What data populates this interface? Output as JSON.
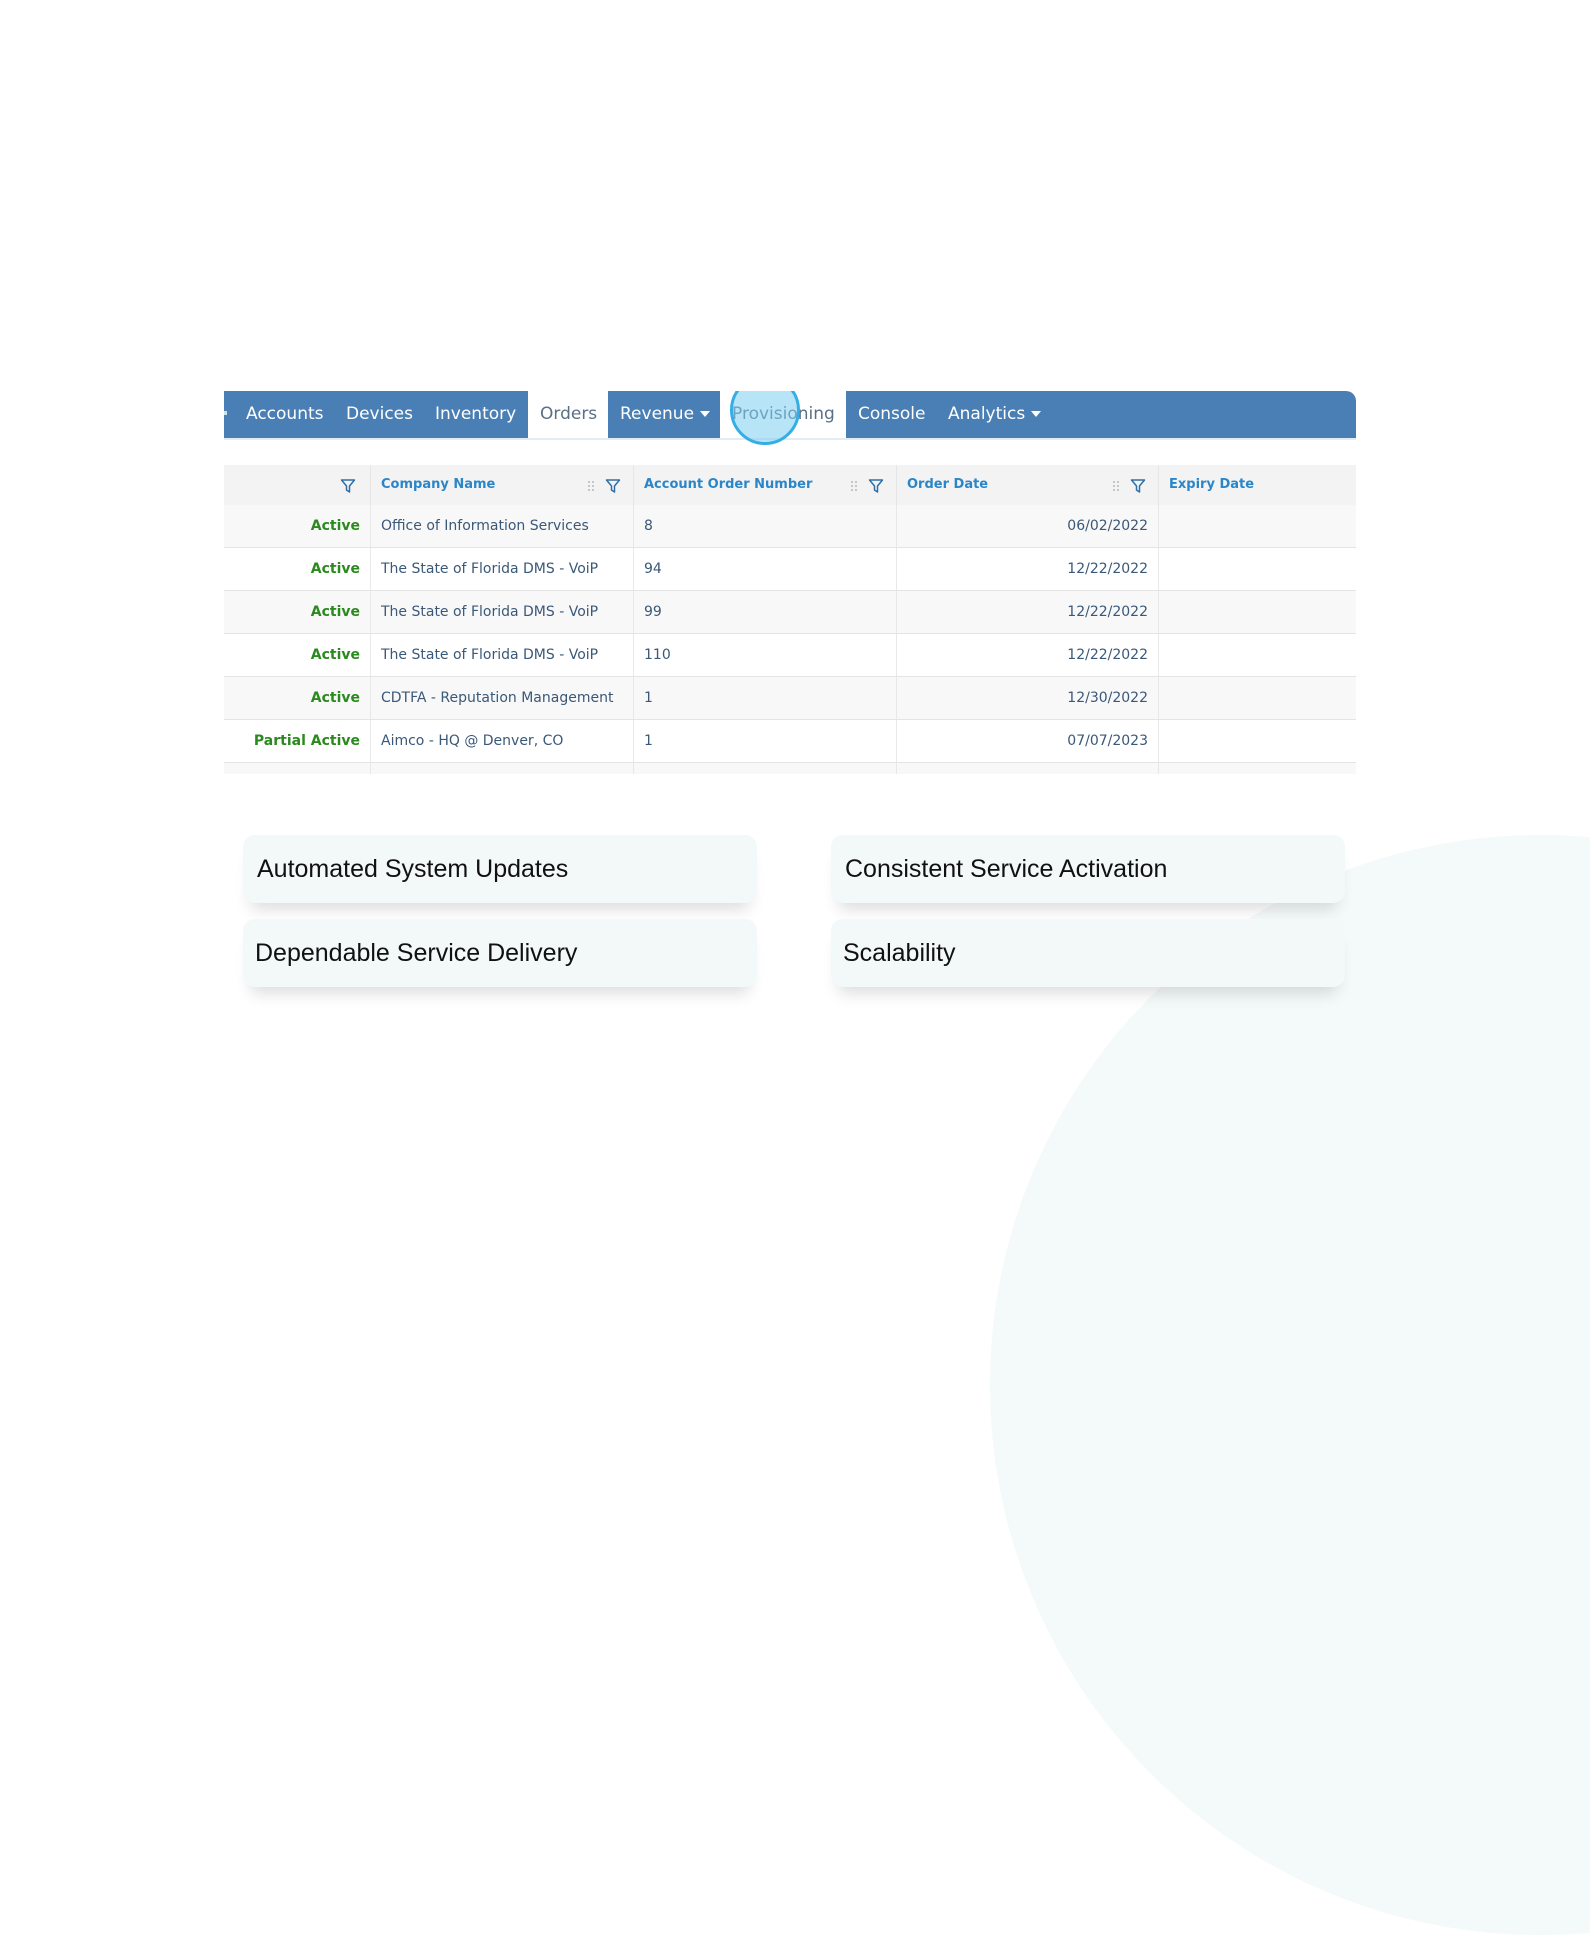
{
  "nav": {
    "tabs": [
      {
        "label": "Accounts",
        "active": false,
        "dropdown": false
      },
      {
        "label": "Devices",
        "active": false,
        "dropdown": false
      },
      {
        "label": "Inventory",
        "active": false,
        "dropdown": false
      },
      {
        "label": "Orders",
        "active": true,
        "dropdown": false
      },
      {
        "label": "Revenue",
        "active": false,
        "dropdown": true
      },
      {
        "label": "Provisioning",
        "active": true,
        "dropdown": false
      },
      {
        "label": "Console",
        "active": false,
        "dropdown": false
      },
      {
        "label": "Analytics",
        "active": false,
        "dropdown": true
      }
    ],
    "bar_color": "#4a7fb5"
  },
  "grid": {
    "columns": [
      {
        "label": "",
        "filter": true,
        "grip": false
      },
      {
        "label": "Company Name",
        "filter": true,
        "grip": true
      },
      {
        "label": "Account Order Number",
        "filter": true,
        "grip": true
      },
      {
        "label": "Order Date",
        "filter": true,
        "grip": true
      },
      {
        "label": "Expiry Date",
        "filter": false,
        "grip": false
      }
    ],
    "rows": [
      {
        "status": "Active",
        "company": "Office of Information Services",
        "order_number": "8",
        "order_date": "06/02/2022",
        "expiry_date": ""
      },
      {
        "status": "Active",
        "company": "The State of Florida DMS - VoiP",
        "order_number": "94",
        "order_date": "12/22/2022",
        "expiry_date": ""
      },
      {
        "status": "Active",
        "company": "The State of Florida DMS - VoiP",
        "order_number": "99",
        "order_date": "12/22/2022",
        "expiry_date": ""
      },
      {
        "status": "Active",
        "company": "The State of Florida DMS - VoiP",
        "order_number": "110",
        "order_date": "12/22/2022",
        "expiry_date": ""
      },
      {
        "status": "Active",
        "company": "CDTFA - Reputation Management",
        "order_number": "1",
        "order_date": "12/30/2022",
        "expiry_date": ""
      },
      {
        "status": "Partial Active",
        "company": "Aimco - HQ @ Denver, CO",
        "order_number": "1",
        "order_date": "07/07/2023",
        "expiry_date": ""
      }
    ],
    "status_color": "#2b8a1e",
    "header_color": "#2a86c8"
  },
  "features": [
    "Automated System Updates",
    "Consistent Service Activation",
    "Dependable Service Delivery",
    "Scalability"
  ]
}
